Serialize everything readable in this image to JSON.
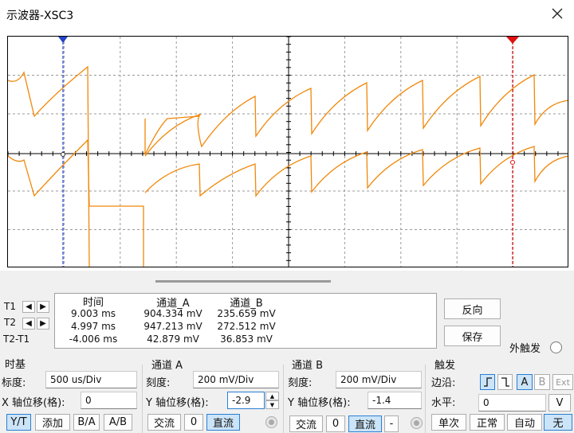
{
  "window": {
    "title": "示波器-XSC3"
  },
  "colors": {
    "trace": "#f0880a",
    "cursor1": "#2244cc",
    "cursor2": "#e01010",
    "grid": "#9a9a9a",
    "selected": "#cce4f7"
  },
  "cursors": {
    "t1_label": "T1",
    "t2_label": "T2",
    "t2t1_label": "T2-T1"
  },
  "measure": {
    "headers": {
      "time": "时间",
      "channel_a": "通道_A",
      "channel_b": "通道_B"
    },
    "rows": [
      {
        "time": "9.003 ms",
        "a": "904.334 mV",
        "b": "235.659 mV"
      },
      {
        "time": "4.997 ms",
        "a": "947.213 mV",
        "b": "272.512 mV"
      },
      {
        "time": "-4.006 ms",
        "a": "42.879 mV",
        "b": "36.853 mV"
      }
    ]
  },
  "actions": {
    "reverse": "反向",
    "save": "保存",
    "ext_trigger": "外触发"
  },
  "timebase": {
    "title": "时基",
    "scale_label": "标度:",
    "scale_value": "500 us/Div",
    "xpos_label": "X 轴位移(格):",
    "xpos_value": "0",
    "modes": [
      "Y/T",
      "添加",
      "B/A",
      "A/B"
    ]
  },
  "channel_a": {
    "title": "通道 A",
    "scale_label": "刻度:",
    "scale_value": "200 mV/Div",
    "ypos_label": "Y 轴位移(格):",
    "ypos_value": "-2.9",
    "coupling": [
      "交流",
      "0",
      "直流"
    ]
  },
  "channel_b": {
    "title": "通道 B",
    "scale_label": "刻度:",
    "scale_value": "200 mV/Div",
    "ypos_label": "Y 轴位移(格):",
    "ypos_value": "-1.4",
    "coupling": [
      "交流",
      "0",
      "直流",
      "-"
    ]
  },
  "trigger": {
    "title": "触发",
    "edge_label": "边沿:",
    "level_label": "水平:",
    "level_value": "0",
    "level_unit": "V",
    "sources": [
      "A",
      "B",
      "Ext"
    ],
    "modes": [
      "单次",
      "正常",
      "自动",
      "无"
    ]
  }
}
